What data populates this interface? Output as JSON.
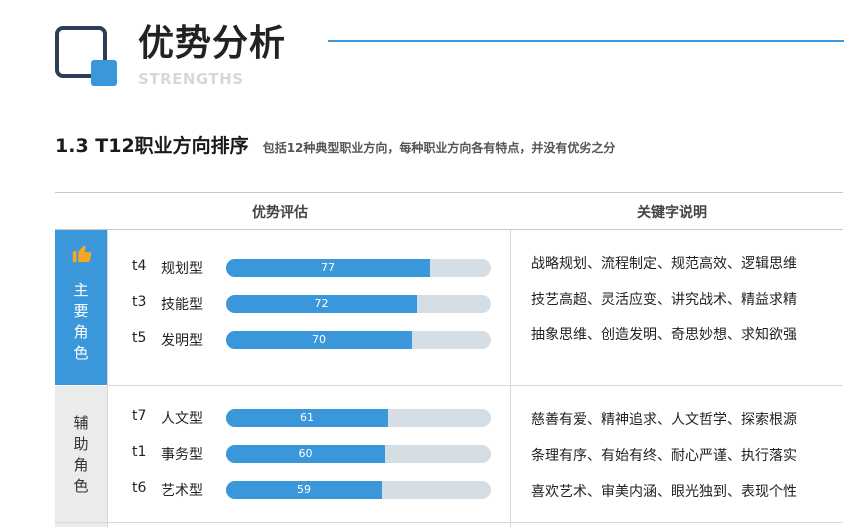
{
  "header": {
    "title": "优势分析",
    "subtitle": "STRENGTHS"
  },
  "section": {
    "heading": "1.3 T12职业方向排序",
    "description": "包括12种典型职业方向，每种职业方向各有特点，并没有优劣之分"
  },
  "table": {
    "col_eval": "优势评估",
    "col_keywords": "关键字说明",
    "groups": [
      {
        "role_chars": [
          "主",
          "要",
          "角",
          "色"
        ],
        "icon": "thumbs-up-icon",
        "rows": [
          {
            "code": "t4",
            "name": "规划型",
            "score": 77,
            "keywords": "战略规划、流程制定、规范高效、逻辑思维"
          },
          {
            "code": "t3",
            "name": "技能型",
            "score": 72,
            "keywords": "技艺高超、灵活应变、讲究战术、精益求精"
          },
          {
            "code": "t5",
            "name": "发明型",
            "score": 70,
            "keywords": "抽象思维、创造发明、奇思妙想、求知欲强"
          }
        ]
      },
      {
        "role_chars": [
          "辅",
          "助",
          "角",
          "色"
        ],
        "rows": [
          {
            "code": "t7",
            "name": "人文型",
            "score": 61,
            "keywords": "慈善有爱、精神追求、人文哲学、探索根源"
          },
          {
            "code": "t1",
            "name": "事务型",
            "score": 60,
            "keywords": "条理有序、有始有终、耐心严谨、执行落实"
          },
          {
            "code": "t6",
            "name": "艺术型",
            "score": 59,
            "keywords": "喜欢艺术、审美内涵、眼光独到、表现个性"
          }
        ]
      }
    ],
    "score_max": 100
  },
  "colors": {
    "accent": "#3a97d9",
    "dark": "#2b3f58",
    "track": "#d6dee5"
  }
}
